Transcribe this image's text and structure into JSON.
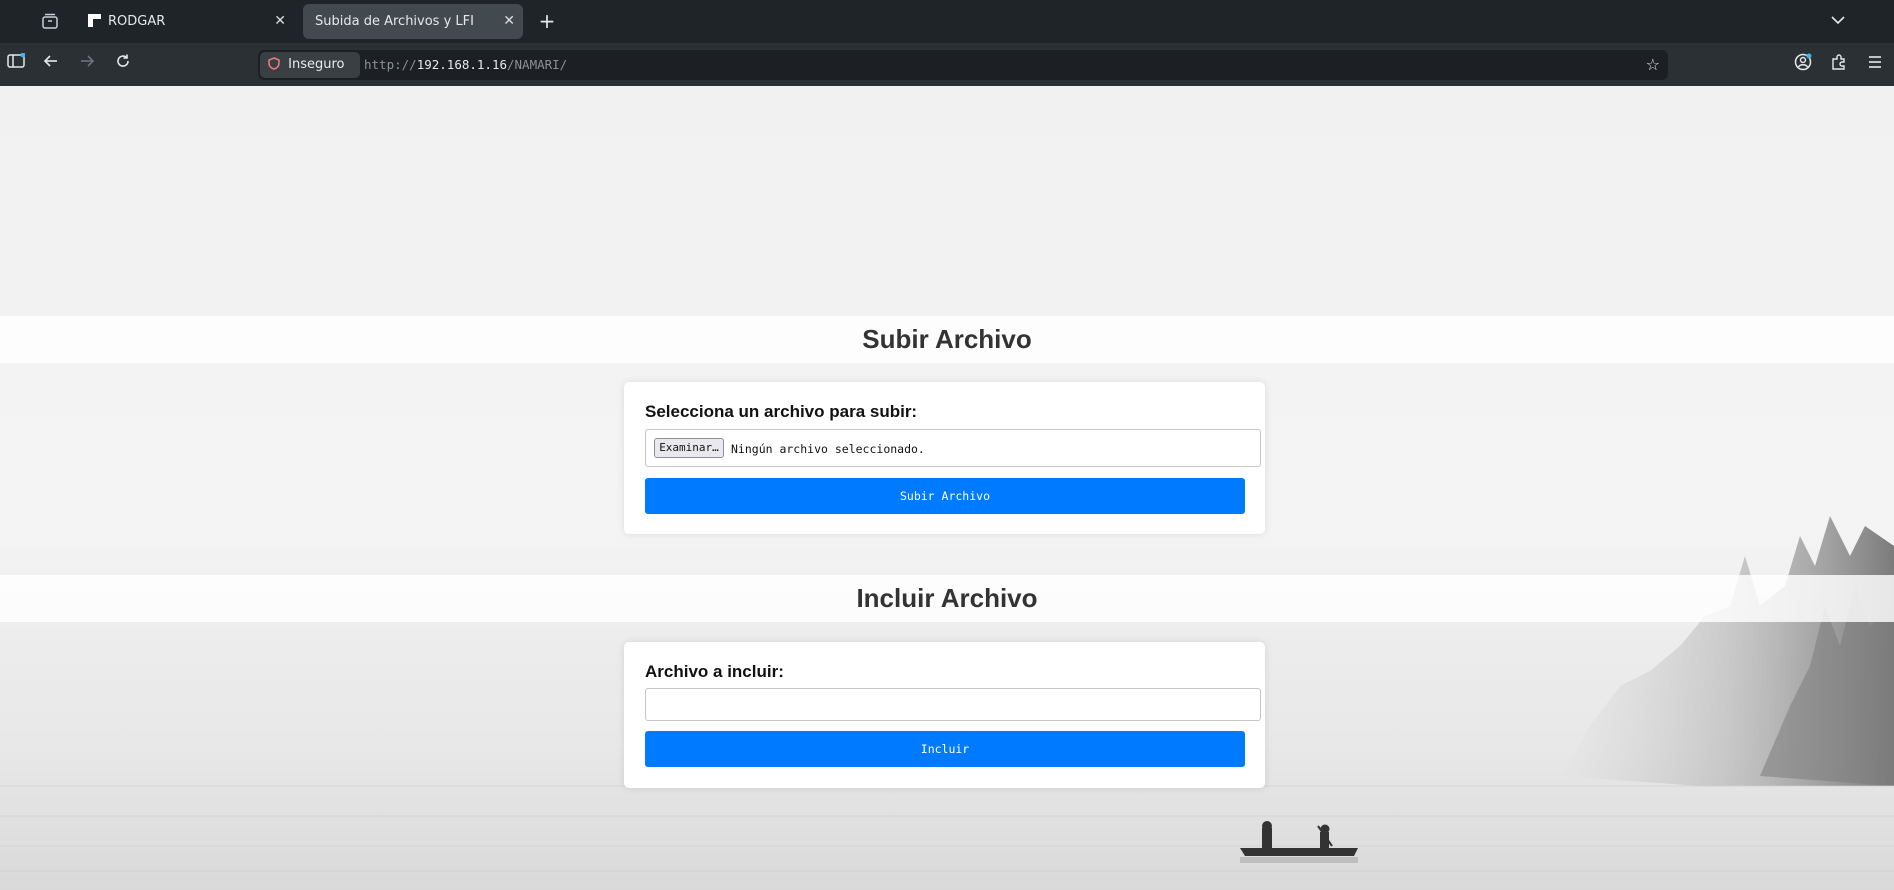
{
  "browser": {
    "tabs": [
      {
        "title": "RODGAR",
        "active": false
      },
      {
        "title": "Subida de Archivos y LFI",
        "active": true
      }
    ],
    "security_label": "Inseguro",
    "url_scheme": "http://",
    "url_host": "192.168.1.16",
    "url_path": "/NAMARI/",
    "icons": {
      "tab_overview": "tab-overview-icon",
      "favicon": "page-favicon-icon",
      "close": "close-icon",
      "new_tab": "plus-icon",
      "tab_list": "chevron-down-icon",
      "sidebar": "sidebar-icon",
      "back": "back-arrow-icon",
      "forward": "forward-arrow-icon",
      "reload": "reload-icon",
      "shield": "shield-icon",
      "bookmark": "star-icon",
      "account": "account-icon",
      "extensions": "puzzle-icon",
      "menu": "hamburger-menu-icon"
    }
  },
  "upload": {
    "heading": "Subir Archivo",
    "label": "Selecciona un archivo para subir:",
    "browse_label": "Examinar…",
    "file_status": "Ningún archivo seleccionado.",
    "button_label": "Subir Archivo"
  },
  "include": {
    "heading": "Incluir Archivo",
    "label": "Archivo a incluir:",
    "input_value": "",
    "button_label": "Incluir"
  },
  "colors": {
    "accent": "#007bff",
    "chrome_dark": "#1f2428",
    "toolbar": "#2b3035"
  }
}
